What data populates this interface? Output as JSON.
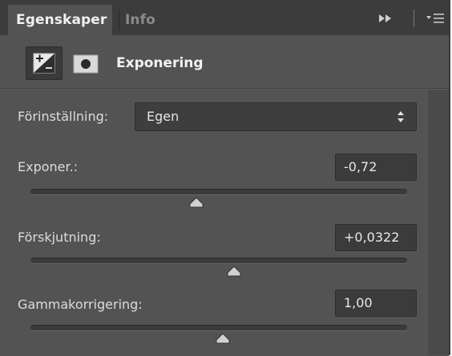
{
  "tabs": [
    {
      "label": "Egenskaper",
      "active": true
    },
    {
      "label": "Info",
      "active": false
    }
  ],
  "header": {
    "title": "Exponering",
    "adjustment_icon": "exposure-icon",
    "mask_icon": "mask-icon"
  },
  "preset": {
    "label": "Förinställning:",
    "value": "Egen"
  },
  "sliders": [
    {
      "label": "Exponer.:",
      "value": "-0,72",
      "position": 0.44
    },
    {
      "label": "Förskjutning:",
      "value": "+0,0322",
      "position": 0.54
    },
    {
      "label": "Gammakorrigering:",
      "value": "1,00",
      "position": 0.51
    }
  ],
  "colors": {
    "panel": "#535353",
    "tabbar": "#3c3c3c",
    "field": "#3b3b3b",
    "text": "#dcdcdc"
  }
}
